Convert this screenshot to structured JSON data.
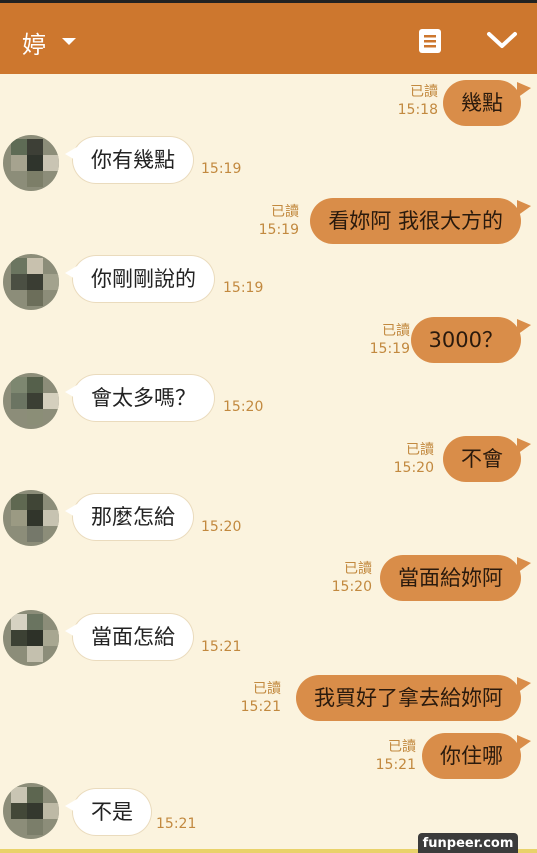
{
  "header": {
    "contact_name": "婷",
    "note_icon": "note-icon",
    "collapse_icon": "chevron-down-icon"
  },
  "colors": {
    "header": "#cd772e",
    "background": "#fbf3de",
    "out_bubble": "#d98d49",
    "in_bubble": "#ffffff",
    "meta": "#c2893f"
  },
  "messages": [
    {
      "dir": "out",
      "text": "幾點",
      "read": "已讀",
      "time": "15:18"
    },
    {
      "dir": "in",
      "text": "你有幾點",
      "time": "15:19"
    },
    {
      "dir": "out",
      "text": "看妳阿 我很大方的",
      "read": "已讀",
      "time": "15:19"
    },
    {
      "dir": "in",
      "text": "你剛剛說的",
      "time": "15:19"
    },
    {
      "dir": "out",
      "text": "3000？",
      "read": "已讀",
      "time": "15:19"
    },
    {
      "dir": "in",
      "text": "會太多嗎？",
      "time": "15:20"
    },
    {
      "dir": "out",
      "text": "不會",
      "read": "已讀",
      "time": "15:20"
    },
    {
      "dir": "in",
      "text": "那麼怎給",
      "time": "15:20"
    },
    {
      "dir": "out",
      "text": "當面給妳阿",
      "read": "已讀",
      "time": "15:20"
    },
    {
      "dir": "in",
      "text": "當面怎給",
      "time": "15:21"
    },
    {
      "dir": "out",
      "text": "我買好了拿去給妳阿",
      "read": "已讀",
      "time": "15:21"
    },
    {
      "dir": "out",
      "text": "你住哪",
      "read": "已讀",
      "time": "15:21"
    },
    {
      "dir": "in",
      "text": "不是",
      "time": "15:21"
    }
  ],
  "watermark": "funpeer.com"
}
